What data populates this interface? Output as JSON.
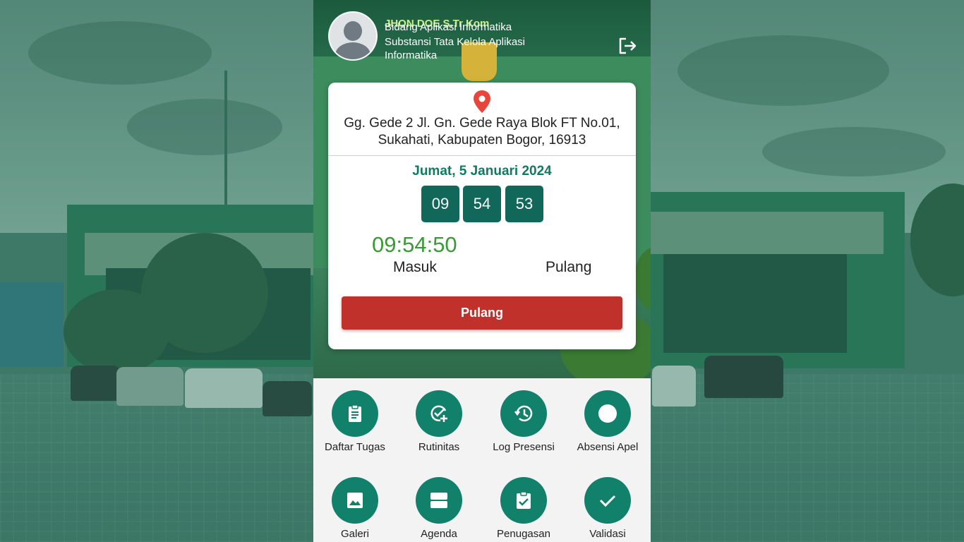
{
  "profile": {
    "name": "JHON DOE S.Tr Kom",
    "line1": "Bidang Aplikasi Informatika",
    "line2": "Substansi Tata Kelola Aplikasi",
    "line3": "Informatika"
  },
  "location": {
    "address_line1": "Gg. Gede 2 Jl. Gn. Gede Raya Blok FT No.01,",
    "address_line2": "Sukahati, Kabupaten Bogor, 16913"
  },
  "attendance": {
    "date": "Jumat, 5 Januari 2024",
    "clock_hours": "09",
    "clock_minutes": "54",
    "clock_seconds": "53",
    "checkin_time": "09:54:50",
    "masuk_label": "Masuk",
    "pulang_label": "Pulang",
    "pulang_button": "Pulang"
  },
  "menu": {
    "items": [
      {
        "label": "Daftar Tugas",
        "icon": "clipboard-icon"
      },
      {
        "label": "Rutinitas",
        "icon": "check-add-icon"
      },
      {
        "label": "Log Presensi",
        "icon": "history-icon"
      },
      {
        "label": "Absensi Apel",
        "icon": "circle-icon"
      },
      {
        "label": "Galeri",
        "icon": "image-icon"
      },
      {
        "label": "Agenda",
        "icon": "agenda-icon"
      },
      {
        "label": "Penugasan",
        "icon": "assignment-icon"
      },
      {
        "label": "Validasi",
        "icon": "checkmark-icon"
      }
    ]
  },
  "colors": {
    "accent": "#12816b",
    "date_color": "#0e7b62",
    "checkin_color": "#3a9a35",
    "button_red": "#c0312b",
    "name_color": "#c8ef8a"
  }
}
